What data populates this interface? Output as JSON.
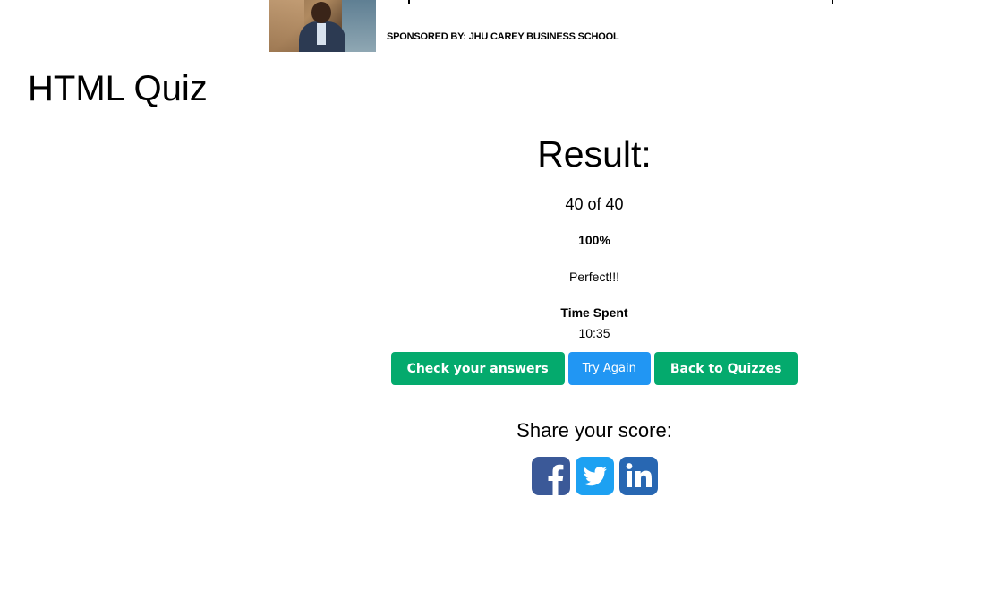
{
  "sponsor": {
    "label": "SPONSORED BY: JHU CAREY BUSINESS SCHOOL",
    "photo_icon": "sponsor-photo"
  },
  "page": {
    "title": "HTML Quiz"
  },
  "result": {
    "heading": "Result:",
    "score": "40 of 40",
    "percent": "100%",
    "verdict": "Perfect!!!",
    "time_label": "Time Spent",
    "time_value": "10:35"
  },
  "buttons": {
    "check_answers": "Check your answers",
    "try_again": "Try Again",
    "back_to_quizzes": "Back to Quizzes"
  },
  "share": {
    "label": "Share your score:",
    "icons": [
      "facebook-icon",
      "twitter-icon",
      "linkedin-icon"
    ]
  },
  "colors": {
    "green_button": "#04aa6d",
    "blue_button": "#2196f3",
    "facebook": "#3b5998",
    "twitter": "#1da1f2",
    "linkedin": "#2867b2"
  }
}
